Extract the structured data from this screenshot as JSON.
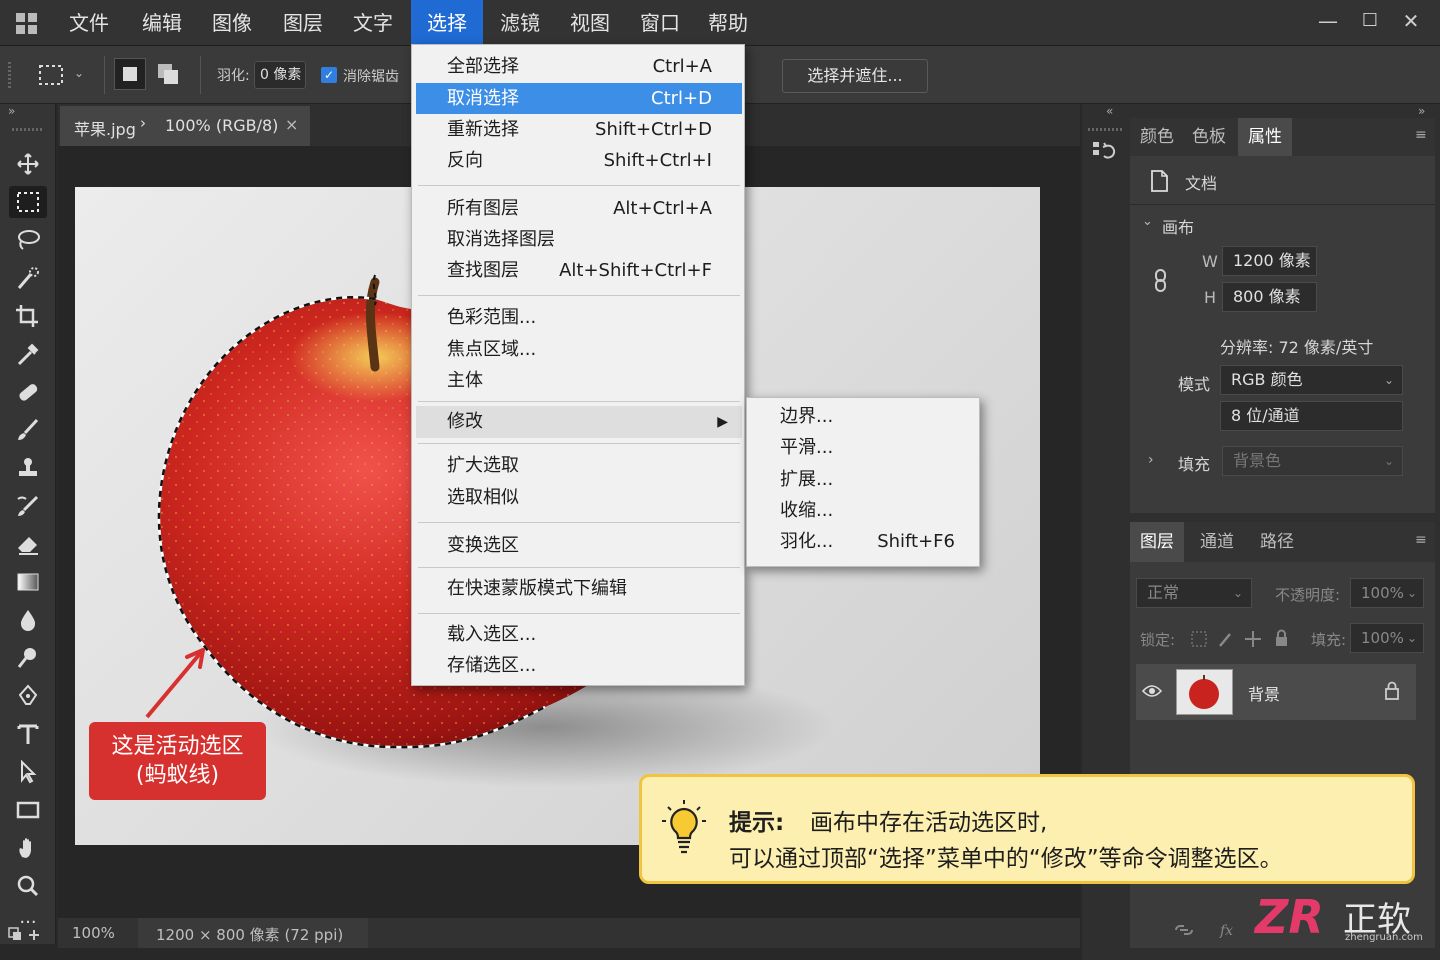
{
  "menubar": {
    "items": [
      "文件",
      "编辑",
      "图像",
      "图层",
      "文字",
      "选择",
      "滤镜",
      "视图",
      "窗口",
      "帮助"
    ],
    "active_index": 5,
    "window_controls": [
      "—",
      "☐",
      "✕"
    ]
  },
  "options_bar": {
    "feather_label": "羽化:",
    "feather_value": "0 像素",
    "antialias_label": "消除锯齿",
    "antialias_checked": true,
    "select_mask_button": "选择并遮住..."
  },
  "document_tab": {
    "name": "苹果.jpg",
    "zoom_mode": "100% (RGB/8)",
    "close": "×"
  },
  "tools": [
    "move-icon",
    "rect-marquee-icon",
    "lasso-icon",
    "quick-select-icon",
    "crop-icon",
    "eyedropper-icon",
    "healing-icon",
    "brush-icon",
    "stamp-icon",
    "history-brush-icon",
    "eraser-icon",
    "gradient-icon",
    "blur-icon",
    "dodge-icon",
    "pen-icon",
    "type-icon",
    "path-select-icon",
    "rectangle-shape-icon",
    "hand-icon",
    "zoom-icon",
    "more-icon"
  ],
  "status": {
    "zoom": "100%",
    "doc_info": "1200 × 800 像素 (72 ppi)"
  },
  "select_menu": {
    "items": [
      {
        "label": "全部选择",
        "shortcut": "Ctrl+A"
      },
      {
        "label": "取消选择",
        "shortcut": "Ctrl+D"
      },
      {
        "label": "重新选择",
        "shortcut": "Shift+Ctrl+D"
      },
      {
        "label": "反向",
        "shortcut": "Shift+Ctrl+I"
      },
      {
        "label": "所有图层",
        "shortcut": "Alt+Ctrl+A"
      },
      {
        "label": "取消选择图层",
        "shortcut": ""
      },
      {
        "label": "查找图层",
        "shortcut": "Alt+Shift+Ctrl+F"
      },
      {
        "label": "色彩范围...",
        "shortcut": ""
      },
      {
        "label": "焦点区域...",
        "shortcut": ""
      },
      {
        "label": "主体",
        "shortcut": ""
      },
      {
        "label": "修改",
        "shortcut": ""
      },
      {
        "label": "扩大选取",
        "shortcut": ""
      },
      {
        "label": "选取相似",
        "shortcut": ""
      },
      {
        "label": "变换选区",
        "shortcut": ""
      },
      {
        "label": "在快速蒙版模式下编辑",
        "shortcut": ""
      },
      {
        "label": "载入选区...",
        "shortcut": ""
      },
      {
        "label": "存储选区...",
        "shortcut": ""
      }
    ],
    "highlighted": "取消选择",
    "submenu_parent": "修改"
  },
  "modify_submenu": {
    "items": [
      {
        "label": "边界...",
        "shortcut": ""
      },
      {
        "label": "平滑...",
        "shortcut": ""
      },
      {
        "label": "扩展...",
        "shortcut": ""
      },
      {
        "label": "收缩...",
        "shortcut": ""
      },
      {
        "label": "羽化...",
        "shortcut": "Shift+F6"
      }
    ]
  },
  "properties_panel": {
    "tabs": [
      "颜色",
      "色板",
      "属性"
    ],
    "active_tab": "属性",
    "doc_label": "文档",
    "canvas_section": "画布",
    "w_label": "W",
    "w_value": "1200 像素",
    "h_label": "H",
    "h_value": "800 像素",
    "resolution": "分辨率: 72 像素/英寸",
    "mode_label": "模式",
    "mode_value": "RGB 颜色",
    "depth_value": "8 位/通道",
    "fill_label": "填充",
    "fill_value": "背景色"
  },
  "layers_panel": {
    "tabs": [
      "图层",
      "通道",
      "路径"
    ],
    "active_tab": "图层",
    "blend_mode": "正常",
    "opacity_label": "不透明度:",
    "opacity_value": "100%",
    "lock_label": "锁定:",
    "fill_label": "填充:",
    "fill_value": "100%",
    "layer_name": "背景"
  },
  "annotation": {
    "line1": "这是活动选区",
    "line2": "(蚂蚁线)"
  },
  "tip": {
    "title": "提示:",
    "line1": "画布中存在活动选区时,",
    "line2": "可以通过顶部“选择”菜单中的“修改”等命令调整选区。"
  },
  "watermark": {
    "logo": "ZR",
    "text": "正软",
    "url": "zhengruan.com"
  },
  "colors": {
    "accent": "#1f6ad3",
    "menu_highlight": "#3d8ee6",
    "apple_red": "#c9231f",
    "annotation_red": "#d6312f",
    "tip_bg": "#fcefb0",
    "tip_border": "#f0c441"
  }
}
